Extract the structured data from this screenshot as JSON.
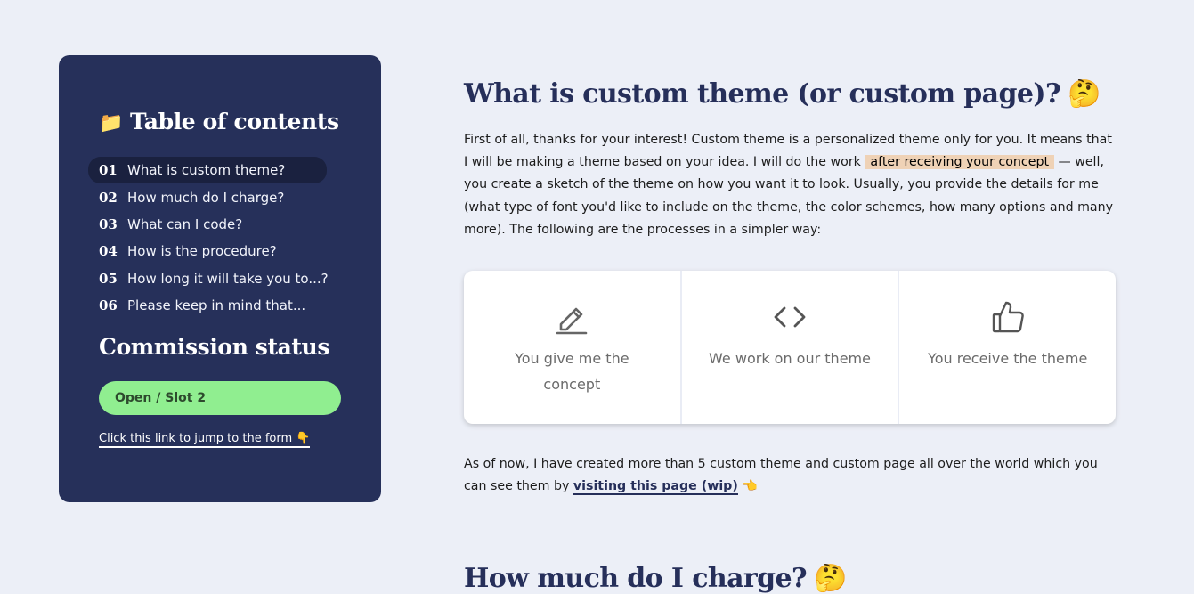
{
  "sidebar": {
    "toc_title": "Table of contents",
    "toc_icon": "📁",
    "items": [
      {
        "num": "01",
        "label": "What is custom theme?"
      },
      {
        "num": "02",
        "label": "How much do I charge?"
      },
      {
        "num": "03",
        "label": "What can I code?"
      },
      {
        "num": "04",
        "label": "How is the procedure?"
      },
      {
        "num": "05",
        "label": "How long it will take you to...?"
      },
      {
        "num": "06",
        "label": "Please keep in mind that..."
      }
    ],
    "status_title": "Commission status",
    "status_value": "Open / Slot 2",
    "status_color": "#90ee90",
    "form_link": "Click this link to jump to the form",
    "form_link_emoji": "👇"
  },
  "main": {
    "heading": "What is custom theme (or custom page)?",
    "heading_emoji": "🤔",
    "intro_before": "First of all, thanks for your interest! Custom theme is a personalized theme only for you. It means that I will be making a theme based on your idea. I will do the work",
    "intro_highlight": "after receiving your concept",
    "intro_after": "— well, you create a sketch of the theme on how you want it to look. Usually, you provide the details for me (what type of font you'd like to include on the theme, the color schemes, how many options and many more). The following are the processes in a simpler way:",
    "cards": [
      {
        "icon": "pencil-icon",
        "text": "You give me the concept"
      },
      {
        "icon": "code-icon",
        "text": "We work on our theme"
      },
      {
        "icon": "thumbs-up-icon",
        "text": "You receive the theme"
      }
    ],
    "outro_before": "As of now, I have created more than 5 custom theme and custom page all over the world which you can see them by",
    "outro_link": "visiting this page (wip)",
    "outro_emoji": "👈",
    "next_heading": "How much do I charge?",
    "next_heading_emoji": "🤔"
  },
  "colors": {
    "navy": "#26305a",
    "background": "#eceff7",
    "highlight": "#efd2b6"
  }
}
